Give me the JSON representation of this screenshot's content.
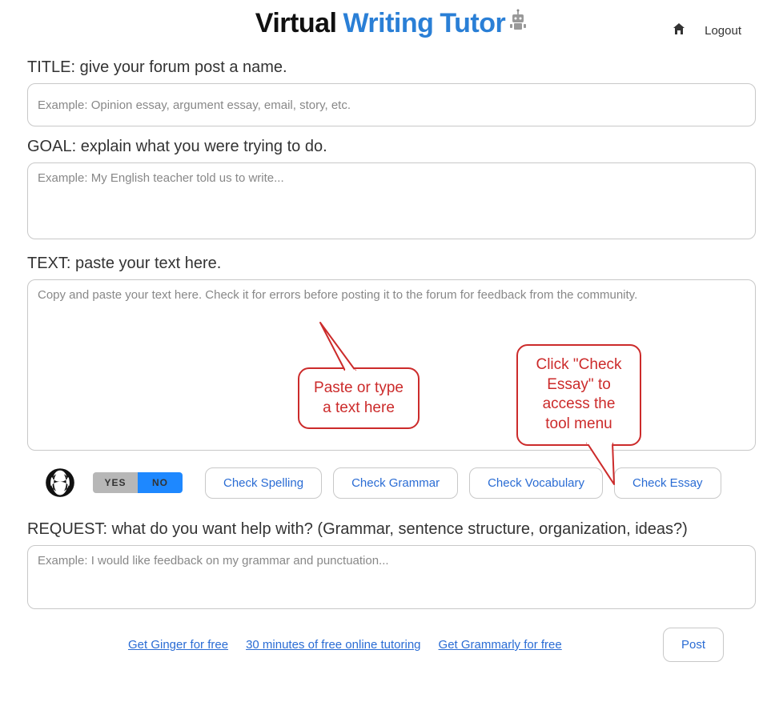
{
  "header": {
    "logo_part1": "Virtual",
    "logo_part2": "Writing",
    "logo_part3": "Tutor",
    "logout": "Logout"
  },
  "fields": {
    "title_label": "TITLE: give your forum post a name.",
    "title_placeholder": "Example: Opinion essay, argument essay, email, story, etc.",
    "goal_label": "GOAL: explain what you were trying to do.",
    "goal_placeholder": "Example: My English teacher told us to write...",
    "text_label": "TEXT: paste your text here.",
    "text_placeholder": "Copy and paste your text here. Check it for errors before posting it to the forum for feedback from the community.",
    "request_label": "REQUEST: what do you want help with? (Grammar, sentence structure, organization, ideas?)",
    "request_placeholder": "Example: I would like feedback on my grammar and punctuation..."
  },
  "toolbar": {
    "yes": "YES",
    "no": "NO",
    "check_spelling": "Check Spelling",
    "check_grammar": "Check Grammar",
    "check_vocabulary": "Check Vocabulary",
    "check_essay": "Check Essay"
  },
  "footer": {
    "ginger": "Get Ginger for free",
    "tutoring": "30 minutes of free online tutoring",
    "grammarly": "Get Grammarly for free",
    "post": "Post"
  },
  "callouts": {
    "paste": "Paste or type\na text here",
    "check": "Click \"Check\nEssay\" to\naccess the\ntool menu"
  }
}
